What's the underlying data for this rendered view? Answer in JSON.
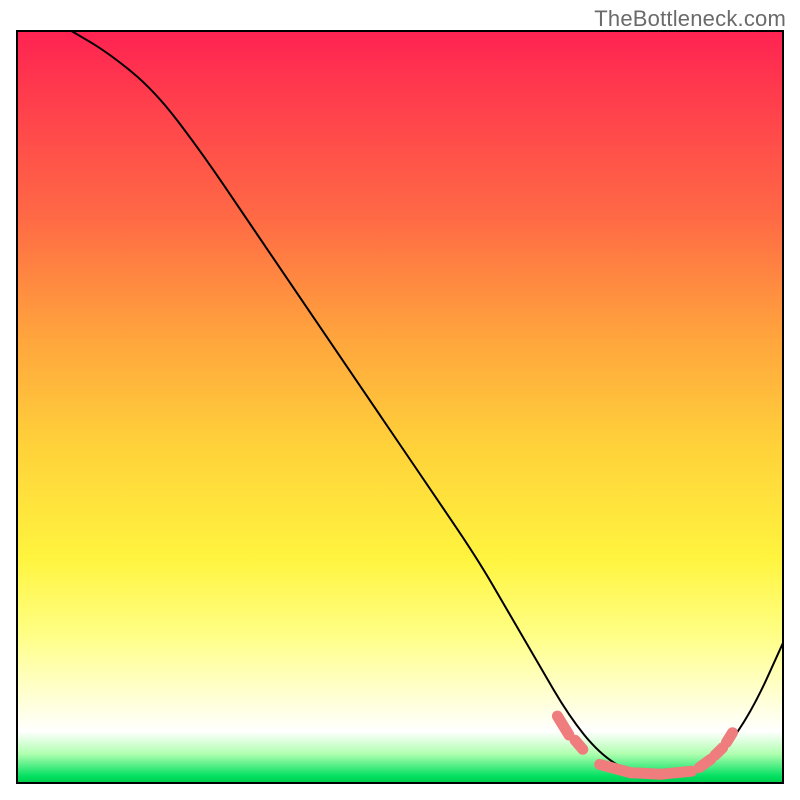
{
  "attribution": "TheBottleneck.com",
  "chart_data": {
    "type": "line",
    "title": "",
    "xlabel": "",
    "ylabel": "",
    "xlim": [
      0,
      100
    ],
    "ylim": [
      0,
      100
    ],
    "grid": false,
    "legend": false,
    "series": [
      {
        "name": "bottleneck-curve",
        "x": [
          7,
          12,
          18,
          24,
          30,
          36,
          42,
          48,
          54,
          60,
          64,
          68,
          72,
          76,
          80,
          84,
          88,
          92,
          96,
          100
        ],
        "y": [
          100,
          97,
          92,
          84,
          75,
          66,
          57,
          48,
          39,
          30,
          23,
          16,
          9,
          4,
          1.5,
          1,
          1.5,
          4,
          10,
          19
        ]
      }
    ],
    "markers": {
      "name": "optimal-range-dots",
      "color": "#ef7d7d",
      "segments": [
        {
          "x": [
            70.5,
            72.0
          ],
          "y": [
            9.0,
            6.5
          ]
        },
        {
          "x": [
            72.8,
            73.8
          ],
          "y": [
            5.8,
            4.6
          ]
        },
        {
          "x": [
            76.0,
            80.0
          ],
          "y": [
            2.6,
            1.5
          ]
        },
        {
          "x": [
            80.0,
            84.0
          ],
          "y": [
            1.5,
            1.3
          ]
        },
        {
          "x": [
            84.0,
            88.0
          ],
          "y": [
            1.3,
            1.7
          ]
        },
        {
          "x": [
            89.0,
            90.5
          ],
          "y": [
            2.2,
            3.3
          ]
        },
        {
          "x": [
            91.0,
            92.0
          ],
          "y": [
            3.8,
            4.8
          ]
        },
        {
          "x": [
            92.5,
            93.3
          ],
          "y": [
            5.5,
            6.8
          ]
        }
      ]
    },
    "background_gradient": {
      "direction": "top_to_bottom",
      "stops": [
        {
          "pos": 0.0,
          "color": "#ff2252"
        },
        {
          "pos": 0.25,
          "color": "#ff6a45"
        },
        {
          "pos": 0.55,
          "color": "#ffd13a"
        },
        {
          "pos": 0.8,
          "color": "#ffff84"
        },
        {
          "pos": 0.93,
          "color": "#ffffff"
        },
        {
          "pos": 1.0,
          "color": "#00c84a"
        }
      ]
    }
  }
}
